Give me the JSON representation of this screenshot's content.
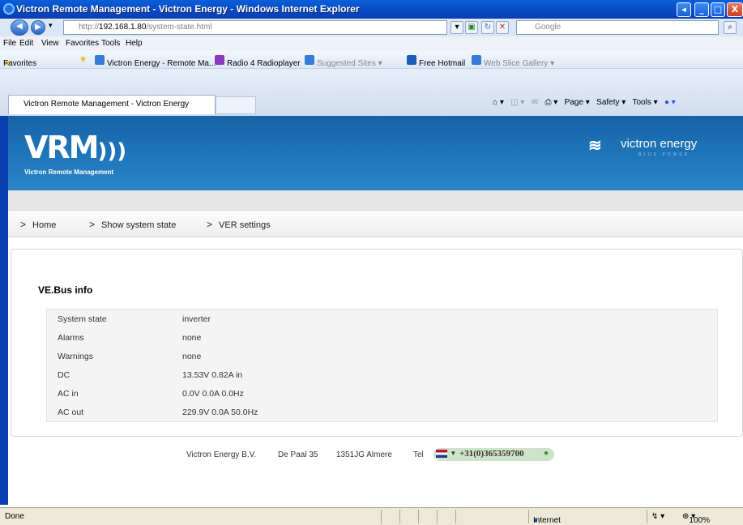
{
  "window": {
    "title": "Victron Remote Management - Victron Energy - Windows Internet Explorer",
    "buttons": {
      "minimize": "_",
      "maximize": "□",
      "close": "X"
    }
  },
  "browser": {
    "address": {
      "prefix": "http://",
      "host": "192.168.1.80",
      "path": "/system-state.html"
    },
    "search_placeholder": "Google",
    "menu": [
      "File",
      "Edit",
      "View",
      "Favorites",
      "Tools",
      "Help"
    ],
    "favorites_label": "Favorites",
    "favorites": [
      "Victron Energy - Remote Ma...",
      "Radio 4 Radioplayer",
      "Suggested Sites ▾",
      "Free Hotmail",
      "Web Slice Gallery ▾"
    ],
    "tab_title": "Victron Remote Management - Victron Energy",
    "command_bar": {
      "page": "Page ▾",
      "safety": "Safety ▾",
      "tools": "Tools ▾"
    }
  },
  "site": {
    "logo_text": "VRM",
    "logo_subtitle": "Victron Remote Management",
    "brand": "victron energy",
    "brand_tagline": "BLUE POWER",
    "nav": [
      "Home",
      "Show system state",
      "VER settings"
    ],
    "section_title": "VE.Bus info",
    "info_rows": [
      {
        "label": "System state",
        "value": "inverter"
      },
      {
        "label": "Alarms",
        "value": "none"
      },
      {
        "label": "Warnings",
        "value": "none"
      },
      {
        "label": "DC",
        "value": "13.53V 0.82A in"
      },
      {
        "label": "AC in",
        "value": "0.0V 0.0A 0.0Hz"
      },
      {
        "label": "AC out",
        "value": "229.9V 0.0A 50.0Hz"
      }
    ],
    "footer": {
      "company": "Victron Energy B.V.",
      "street": "De Paal 35",
      "city": "1351JG Almere",
      "tel_label": "Tel",
      "phone": "+31(0)365359700"
    }
  },
  "status": {
    "left": "Done",
    "zone": "Internet",
    "zoom": "100%"
  },
  "colors": {
    "banner": "#1e74b8",
    "titlebar": "#0848c4"
  }
}
